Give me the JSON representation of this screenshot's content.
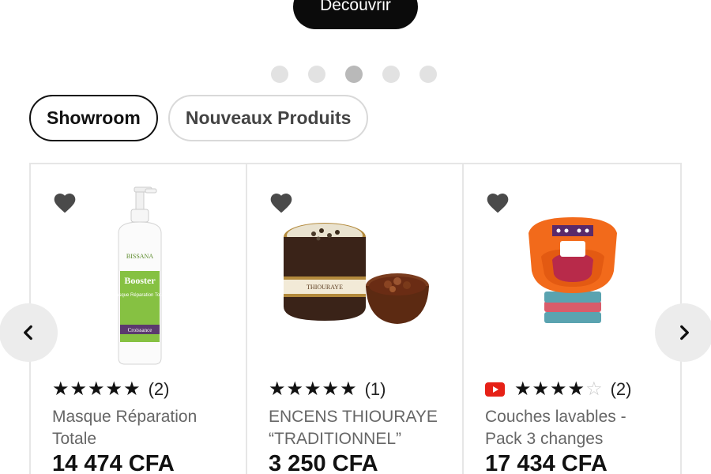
{
  "hero": {
    "cta_label": "Découvrir"
  },
  "carousel": {
    "dot_count": 5,
    "active_index": 2
  },
  "tabs": [
    {
      "label": "Showroom",
      "active": true
    },
    {
      "label": "Nouveaux Produits",
      "active": false
    }
  ],
  "products": [
    {
      "name": "Masque Réparation Totale",
      "price": "14 474 CFA",
      "rating": 5,
      "review_count": "(2)",
      "has_video_badge": false,
      "image_icon": "hair-mask-bottle-image",
      "label_brand": "BISSANA",
      "label_line": "Booster",
      "label_sub": "Masque Réparation Totale",
      "label_band": "Croissance"
    },
    {
      "name": "ENCENS THIOURAYE “TRADITIONNEL”",
      "price": "3 250 CFA",
      "rating": 5,
      "review_count": "(1)",
      "has_video_badge": false,
      "image_icon": "incense-jar-image",
      "label_brand": "THIOURAYE"
    },
    {
      "name": "Couches lavables - Pack 3 changes",
      "price": "17 434 CFA",
      "rating": 4,
      "review_count": "(2)",
      "has_video_badge": true,
      "image_icon": "cloth-diaper-image"
    }
  ],
  "nav": {
    "prev_icon": "chevron-left-icon",
    "next_icon": "chevron-right-icon"
  },
  "colors": {
    "accent": "#0b0b0b",
    "video_badge": "#e62117",
    "diaper_orange": "#f26a1b",
    "bottle_green": "#7dbb38"
  }
}
